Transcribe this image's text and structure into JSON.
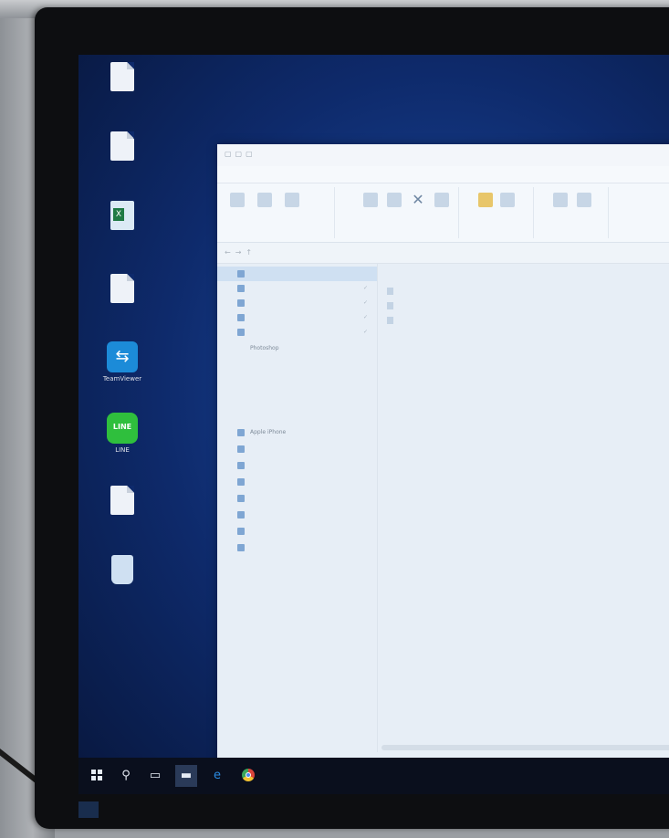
{
  "desktop": {
    "icons": [
      {
        "label": "",
        "kind": "doc"
      },
      {
        "label": "",
        "kind": "doc"
      },
      {
        "label": "",
        "kind": "xls"
      },
      {
        "label": "",
        "kind": "doc"
      },
      {
        "label": "TeamViewer",
        "kind": "teamviewer"
      },
      {
        "label": "LINE",
        "kind": "line"
      },
      {
        "label": "",
        "kind": "doc"
      },
      {
        "label": "",
        "kind": "recycle-bin"
      }
    ]
  },
  "explorer": {
    "ribbon_tabs": [
      "",
      "",
      "",
      ""
    ],
    "address_path": "",
    "nav_items": [
      {
        "label": "",
        "selected": true
      },
      {
        "label": "",
        "pinned": true
      },
      {
        "label": "",
        "pinned": true
      },
      {
        "label": "",
        "pinned": true
      },
      {
        "label": "",
        "pinned": true
      },
      {
        "label": "Photoshop"
      },
      {
        "label": ""
      },
      {
        "label": ""
      },
      {
        "label": "Apple iPhone"
      },
      {
        "label": ""
      },
      {
        "label": ""
      },
      {
        "label": ""
      },
      {
        "label": ""
      },
      {
        "label": ""
      },
      {
        "label": ""
      },
      {
        "label": ""
      }
    ],
    "files": [
      {
        "name": "",
        "date": "",
        "type": ""
      },
      {
        "name": "",
        "date": "",
        "type": ""
      },
      {
        "name": "",
        "date": "",
        "type": ""
      }
    ],
    "status": ""
  },
  "taskbar": {
    "items": [
      "start",
      "search",
      "task-view",
      "file-explorer",
      "edge",
      "chrome"
    ],
    "active": "file-explorer"
  },
  "colors": {
    "desktop_blue": "#0e2a6b",
    "ribbon_accent": "#2b6fce",
    "taskbar": "#0a0f1d"
  }
}
